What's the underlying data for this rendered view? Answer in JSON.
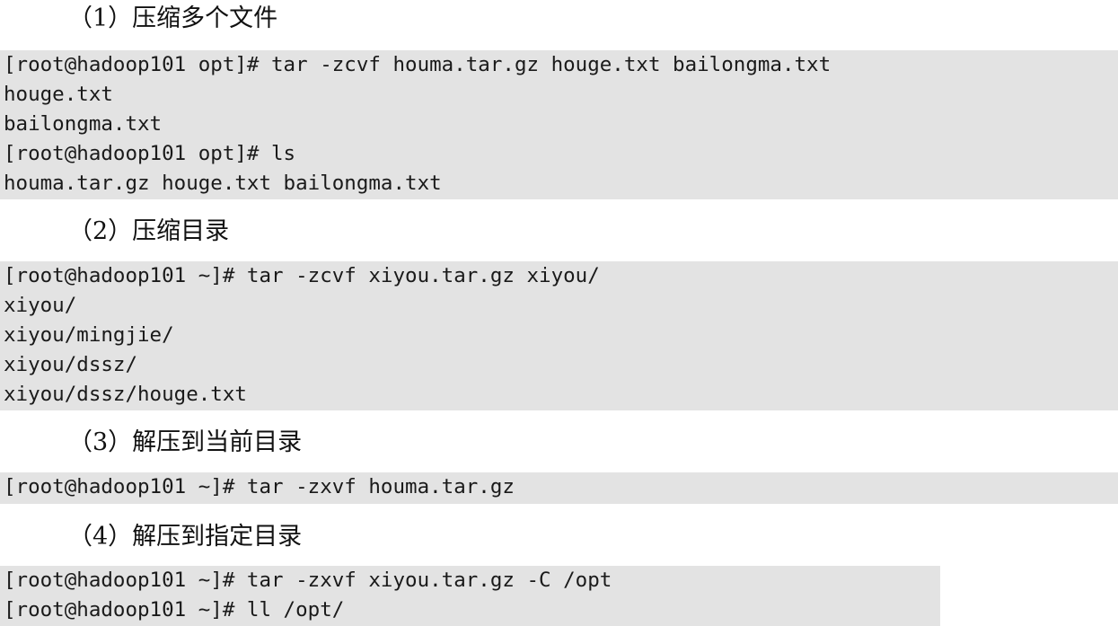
{
  "sections": [
    {
      "heading": "（1）压缩多个文件",
      "lines": [
        "[root@hadoop101 opt]# tar -zcvf houma.tar.gz houge.txt bailongma.txt",
        "houge.txt",
        "bailongma.txt",
        "[root@hadoop101 opt]# ls",
        "houma.tar.gz houge.txt bailongma.txt"
      ]
    },
    {
      "heading": "（2）压缩目录",
      "lines": [
        "[root@hadoop101 ~]# tar -zcvf xiyou.tar.gz xiyou/",
        "xiyou/",
        "xiyou/mingjie/",
        "xiyou/dssz/",
        "xiyou/dssz/houge.txt"
      ]
    },
    {
      "heading": "（3）解压到当前目录",
      "lines": [
        "[root@hadoop101 ~]# tar -zxvf houma.tar.gz"
      ]
    },
    {
      "heading": "（4）解压到指定目录",
      "lines": [
        "[root@hadoop101 ~]# tar -zxvf xiyou.tar.gz -C /opt",
        "[root@hadoop101 ~]# ll /opt/"
      ]
    }
  ]
}
